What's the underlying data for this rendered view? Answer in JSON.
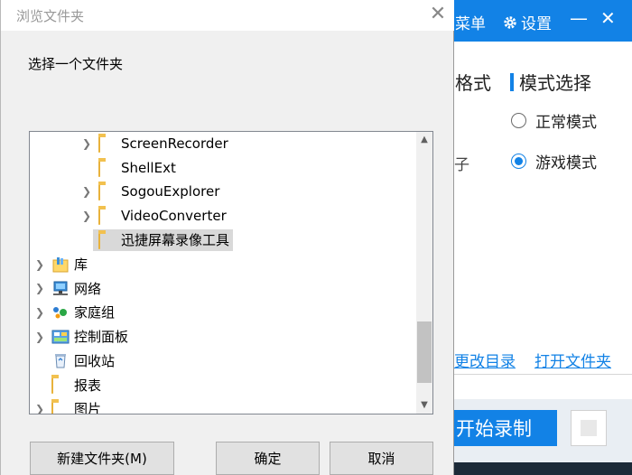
{
  "background_app": {
    "menu_label": "菜单",
    "settings_label": "设置",
    "settings_icon": "gear-icon",
    "minimize_glyph": "—",
    "close_glyph": "✕",
    "format_tail": "格式",
    "mode_header": "模式选择",
    "radio_normal": "正常模式",
    "radio_game": "游戏模式",
    "selected_mode": "游戏模式",
    "left_tail": "子",
    "change_dir_link": "更改目录",
    "open_folder_link": "打开文件夹",
    "start_button": "开始录制",
    "accent_color": "#1282e6"
  },
  "dialog": {
    "title": "浏览文件夹",
    "close_glyph": "✕",
    "prompt": "选择一个文件夹",
    "tree": [
      {
        "label": "ScreenRecorder",
        "icon": "folder-icon",
        "expandable": true,
        "level": 2
      },
      {
        "label": "ShellExt",
        "icon": "folder-icon",
        "expandable": false,
        "level": 2
      },
      {
        "label": "SogouExplorer",
        "icon": "folder-icon",
        "expandable": true,
        "level": 2
      },
      {
        "label": "VideoConverter",
        "icon": "folder-icon",
        "expandable": true,
        "level": 2
      },
      {
        "label": "迅捷屏幕录像工具",
        "icon": "folder-icon",
        "expandable": false,
        "level": 2,
        "selected": true
      },
      {
        "label": "库",
        "icon": "library-icon",
        "expandable": true,
        "level": 0
      },
      {
        "label": "网络",
        "icon": "network-icon",
        "expandable": true,
        "level": 0
      },
      {
        "label": "家庭组",
        "icon": "homegroup-icon",
        "expandable": true,
        "level": 0
      },
      {
        "label": "控制面板",
        "icon": "control-panel-icon",
        "expandable": true,
        "level": 0
      },
      {
        "label": "回收站",
        "icon": "recycle-bin-icon",
        "expandable": false,
        "level": 0
      },
      {
        "label": "报表",
        "icon": "folder-icon",
        "expandable": false,
        "level": 0
      },
      {
        "label": "图片",
        "icon": "folder-icon",
        "expandable": true,
        "level": 0
      }
    ],
    "buttons": {
      "new_folder": "新建文件夹(M)",
      "ok": "确定",
      "cancel": "取消"
    }
  }
}
